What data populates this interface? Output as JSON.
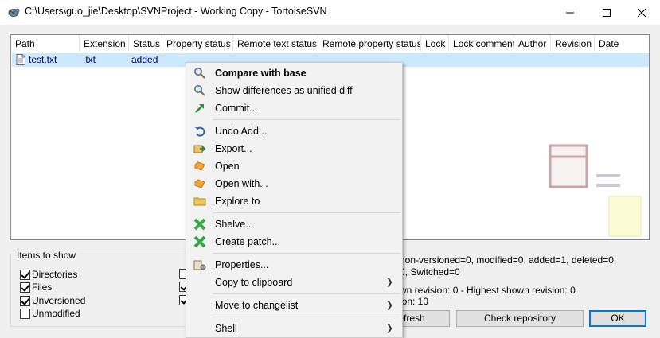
{
  "window": {
    "title": "C:\\Users\\guo_jie\\Desktop\\SVNProject - Working Copy - TortoiseSVN"
  },
  "list": {
    "columns": [
      "Path",
      "Extension",
      "Status",
      "Property status",
      "Remote text status",
      "Remote property status",
      "Lock",
      "Lock comment",
      "Author",
      "Revision",
      "Date"
    ],
    "rows": [
      {
        "path": "test.txt",
        "extension": ".txt",
        "status": "added"
      }
    ]
  },
  "items_to_show": {
    "title": "Items to show",
    "options": [
      {
        "label": "Directories",
        "checked": true
      },
      {
        "label": "Files",
        "checked": true
      },
      {
        "label": "Unversioned",
        "checked": true
      },
      {
        "label": "Unmodified",
        "checked": false
      }
    ]
  },
  "summary": {
    "line1": "non-versioned=0, modified=0, added=1, deleted=0,",
    "line2": "0, Switched=0",
    "line3": "wn revision: 0 - Highest shown revision: 0",
    "line4": "ion: 10"
  },
  "buttons": {
    "refresh": "efresh",
    "check_repository": "Check repository",
    "ok": "OK"
  },
  "context_menu": {
    "items": [
      {
        "label": "Compare with base",
        "icon": "compare-icon",
        "bold": true
      },
      {
        "label": "Show differences as unified diff",
        "icon": "diff-icon"
      },
      {
        "label": "Commit...",
        "icon": "commit-icon"
      },
      {
        "label": "Undo Add...",
        "icon": "undo-icon"
      },
      {
        "label": "Export...",
        "icon": "export-icon"
      },
      {
        "label": "Open",
        "icon": "open-icon"
      },
      {
        "label": "Open with...",
        "icon": "open-with-icon"
      },
      {
        "label": "Explore to",
        "icon": "folder-icon"
      },
      {
        "label": "Shelve...",
        "icon": "shelve-icon"
      },
      {
        "label": "Create patch...",
        "icon": "patch-icon"
      },
      {
        "label": "Properties...",
        "icon": "properties-icon"
      },
      {
        "label": "Copy to clipboard",
        "submenu": true
      },
      {
        "label": "Move to changelist",
        "submenu": true
      },
      {
        "label": "Shell",
        "submenu": true
      }
    ]
  }
}
